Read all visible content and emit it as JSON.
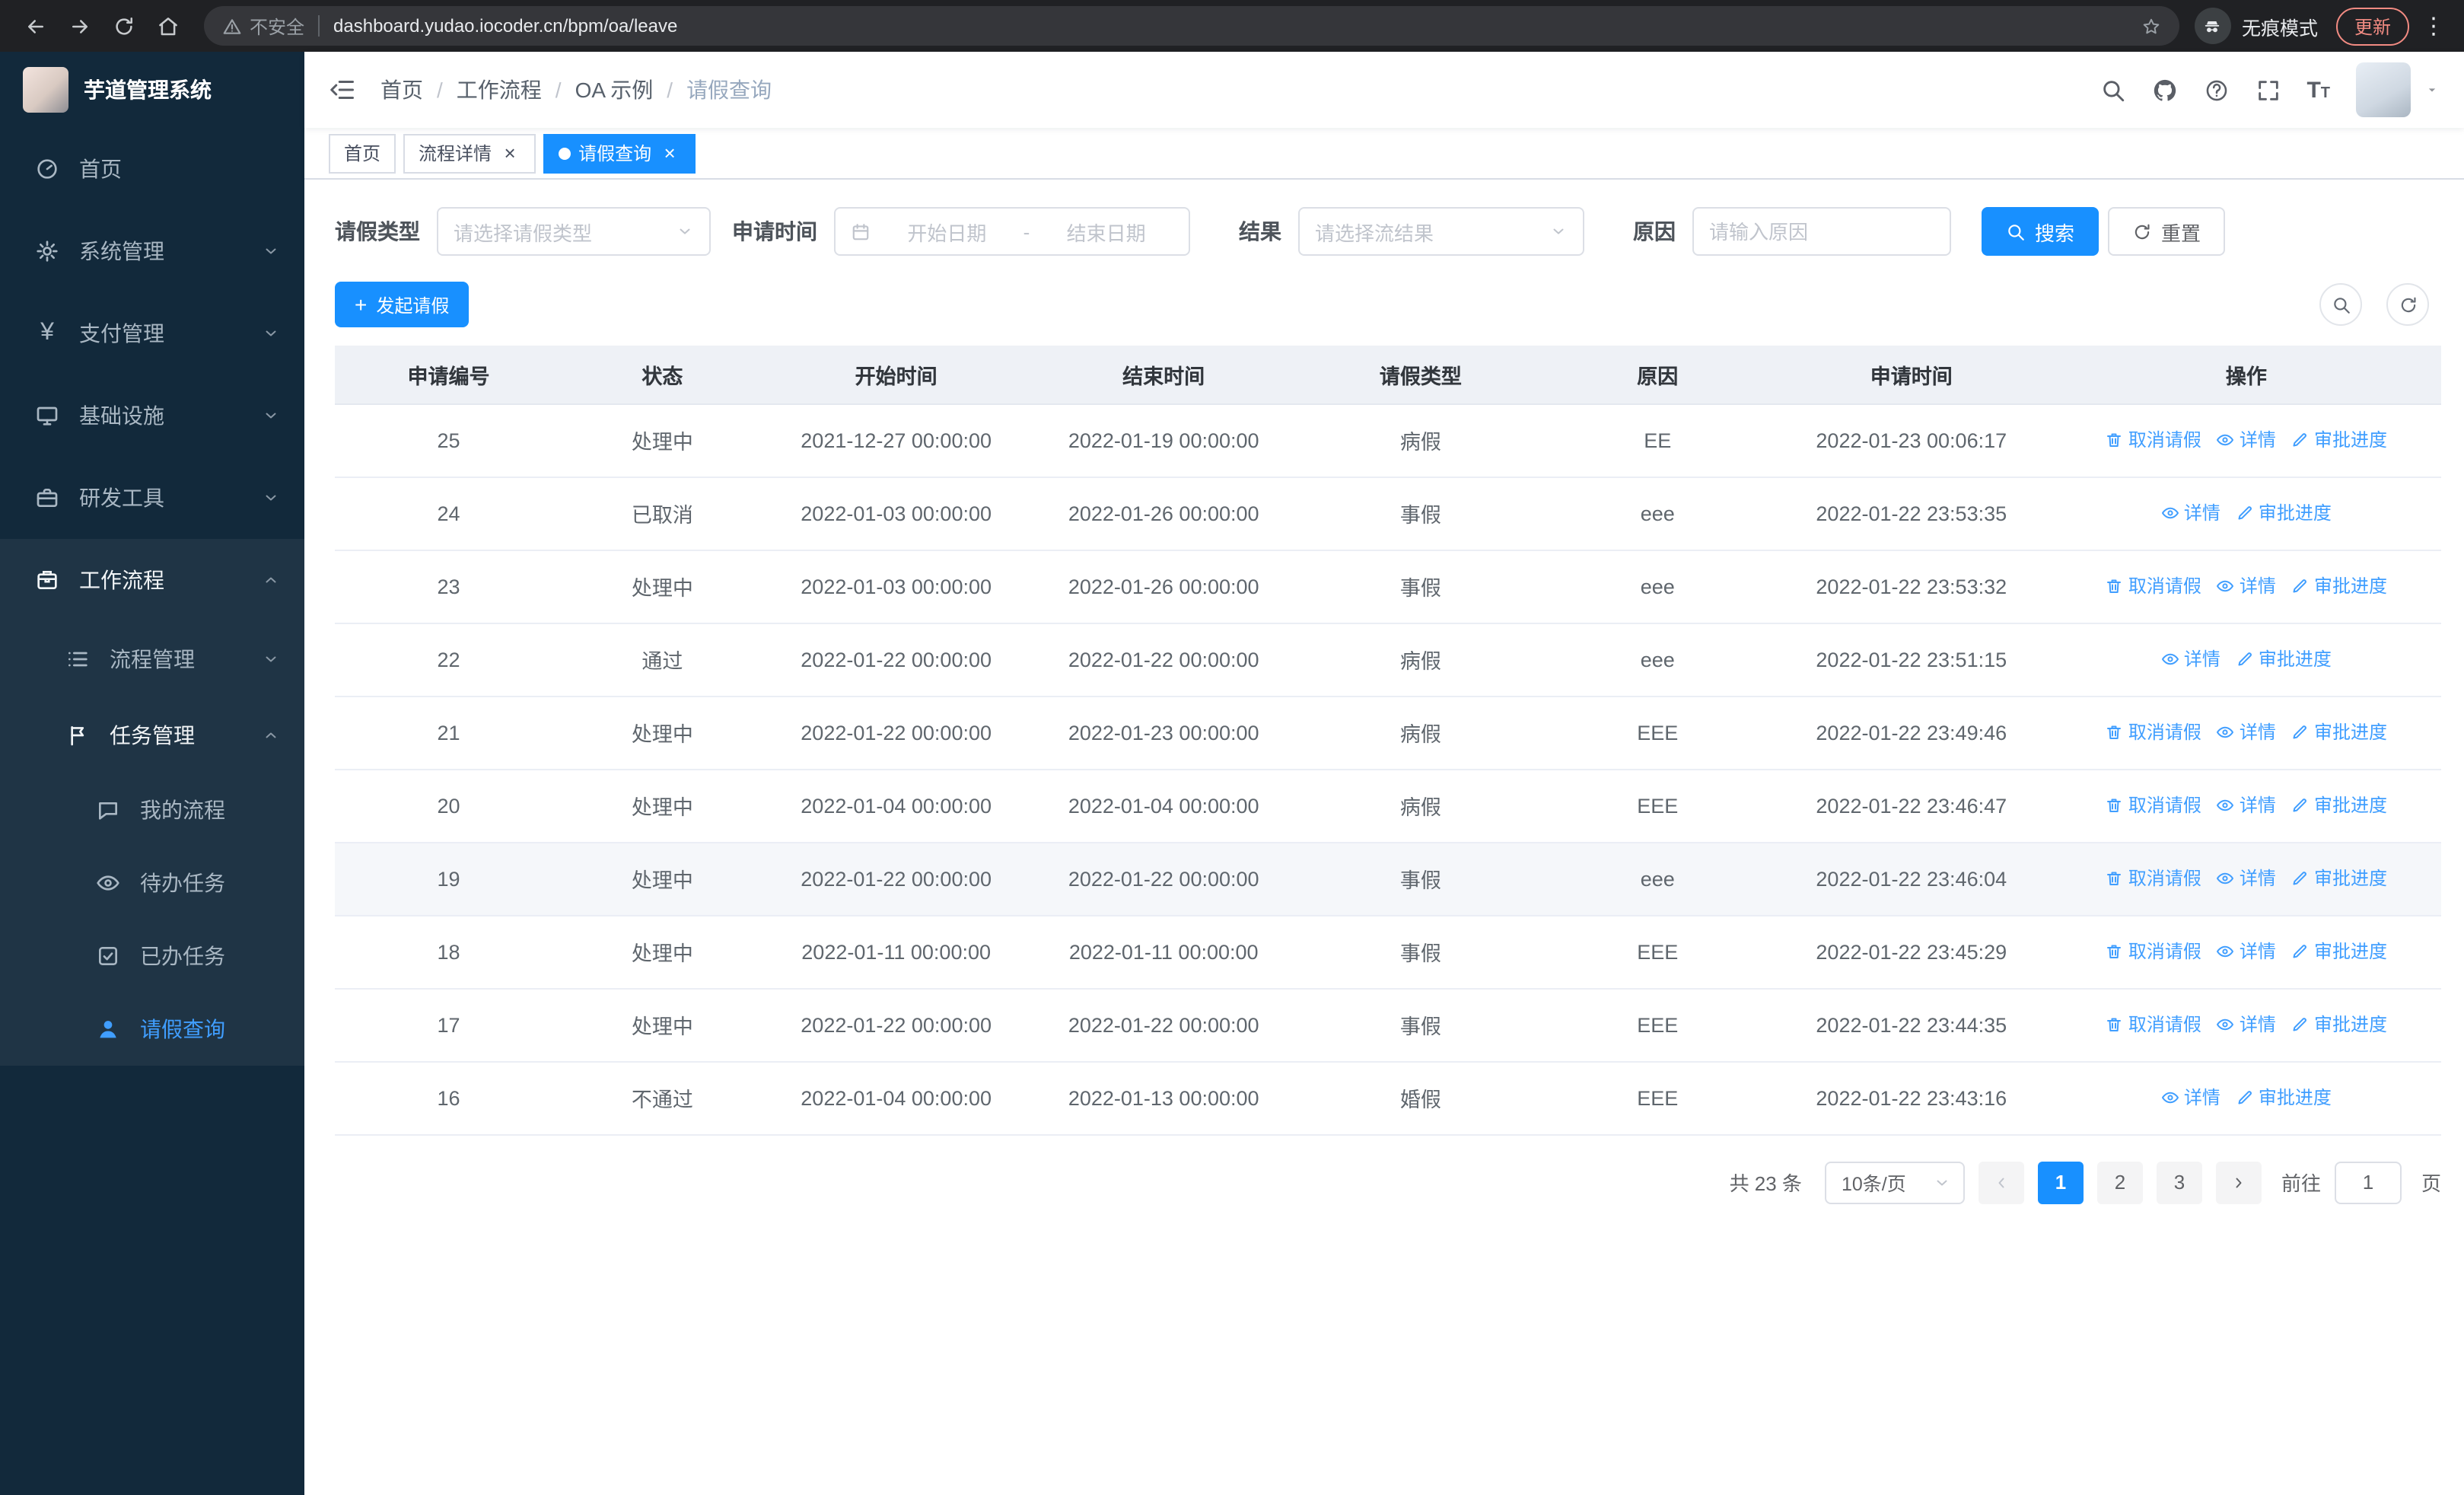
{
  "colors": {
    "accent": "#1890ff",
    "link": "#409eff",
    "sidebar_bg": "#12293b",
    "update_badge": "#f28b82"
  },
  "browser": {
    "security_label": "不安全",
    "url": "dashboard.yudao.iocoder.cn/bpm/oa/leave",
    "profile_label": "无痕模式",
    "update_label": "更新"
  },
  "sidebar": {
    "logo_title": "芋道管理系统",
    "items": [
      {
        "label": "首页"
      },
      {
        "label": "系统管理"
      },
      {
        "label": "支付管理"
      },
      {
        "label": "基础设施"
      },
      {
        "label": "研发工具"
      },
      {
        "label": "工作流程"
      },
      {
        "label": "流程管理"
      },
      {
        "label": "任务管理"
      },
      {
        "label": "我的流程"
      },
      {
        "label": "待办任务"
      },
      {
        "label": "已办任务"
      },
      {
        "label": "请假查询"
      }
    ]
  },
  "header": {
    "breadcrumb": [
      "首页",
      "工作流程",
      "OA 示例",
      "请假查询"
    ]
  },
  "tabs": [
    {
      "label": "首页"
    },
    {
      "label": "流程详情"
    },
    {
      "label": "请假查询"
    }
  ],
  "filters": {
    "leave_type_label": "请假类型",
    "leave_type_placeholder": "请选择请假类型",
    "apply_time_label": "申请时间",
    "start_date_placeholder": "开始日期",
    "range_separator": "-",
    "end_date_placeholder": "结束日期",
    "result_label": "结果",
    "result_placeholder": "请选择流结果",
    "reason_label": "原因",
    "reason_placeholder": "请输入原因",
    "search_label": "搜索",
    "reset_label": "重置"
  },
  "toolbar": {
    "create_label": "发起请假"
  },
  "table": {
    "columns": [
      "申请编号",
      "状态",
      "开始时间",
      "结束时间",
      "请假类型",
      "原因",
      "申请时间",
      "操作"
    ],
    "action_labels": {
      "cancel": "取消请假",
      "detail": "详情",
      "progress": "审批进度"
    },
    "rows": [
      {
        "id": "25",
        "status": "处理中",
        "start": "2021-12-27 00:00:00",
        "end": "2022-01-19 00:00:00",
        "type": "病假",
        "reason": "EE",
        "apply_time": "2022-01-23 00:06:17",
        "actions": [
          "cancel",
          "detail",
          "progress"
        ]
      },
      {
        "id": "24",
        "status": "已取消",
        "start": "2022-01-03 00:00:00",
        "end": "2022-01-26 00:00:00",
        "type": "事假",
        "reason": "eee",
        "apply_time": "2022-01-22 23:53:35",
        "actions": [
          "detail",
          "progress"
        ]
      },
      {
        "id": "23",
        "status": "处理中",
        "start": "2022-01-03 00:00:00",
        "end": "2022-01-26 00:00:00",
        "type": "事假",
        "reason": "eee",
        "apply_time": "2022-01-22 23:53:32",
        "actions": [
          "cancel",
          "detail",
          "progress"
        ]
      },
      {
        "id": "22",
        "status": "通过",
        "start": "2022-01-22 00:00:00",
        "end": "2022-01-22 00:00:00",
        "type": "病假",
        "reason": "eee",
        "apply_time": "2022-01-22 23:51:15",
        "actions": [
          "detail",
          "progress"
        ]
      },
      {
        "id": "21",
        "status": "处理中",
        "start": "2022-01-22 00:00:00",
        "end": "2022-01-23 00:00:00",
        "type": "病假",
        "reason": "EEE",
        "apply_time": "2022-01-22 23:49:46",
        "actions": [
          "cancel",
          "detail",
          "progress"
        ]
      },
      {
        "id": "20",
        "status": "处理中",
        "start": "2022-01-04 00:00:00",
        "end": "2022-01-04 00:00:00",
        "type": "病假",
        "reason": "EEE",
        "apply_time": "2022-01-22 23:46:47",
        "actions": [
          "cancel",
          "detail",
          "progress"
        ]
      },
      {
        "id": "19",
        "status": "处理中",
        "start": "2022-01-22 00:00:00",
        "end": "2022-01-22 00:00:00",
        "type": "事假",
        "reason": "eee",
        "apply_time": "2022-01-22 23:46:04",
        "actions": [
          "cancel",
          "detail",
          "progress"
        ],
        "highlighted": true
      },
      {
        "id": "18",
        "status": "处理中",
        "start": "2022-01-11 00:00:00",
        "end": "2022-01-11 00:00:00",
        "type": "事假",
        "reason": "EEE",
        "apply_time": "2022-01-22 23:45:29",
        "actions": [
          "cancel",
          "detail",
          "progress"
        ]
      },
      {
        "id": "17",
        "status": "处理中",
        "start": "2022-01-22 00:00:00",
        "end": "2022-01-22 00:00:00",
        "type": "事假",
        "reason": "EEE",
        "apply_time": "2022-01-22 23:44:35",
        "actions": [
          "cancel",
          "detail",
          "progress"
        ]
      },
      {
        "id": "16",
        "status": "不通过",
        "start": "2022-01-04 00:00:00",
        "end": "2022-01-13 00:00:00",
        "type": "婚假",
        "reason": "EEE",
        "apply_time": "2022-01-22 23:43:16",
        "actions": [
          "detail",
          "progress"
        ]
      }
    ]
  },
  "pagination": {
    "total_text": "共 23 条",
    "page_size": "10条/页",
    "pages": [
      "1",
      "2",
      "3"
    ],
    "active_page": "1",
    "goto_label": "前往",
    "goto_value": "1",
    "goto_suffix": "页"
  }
}
